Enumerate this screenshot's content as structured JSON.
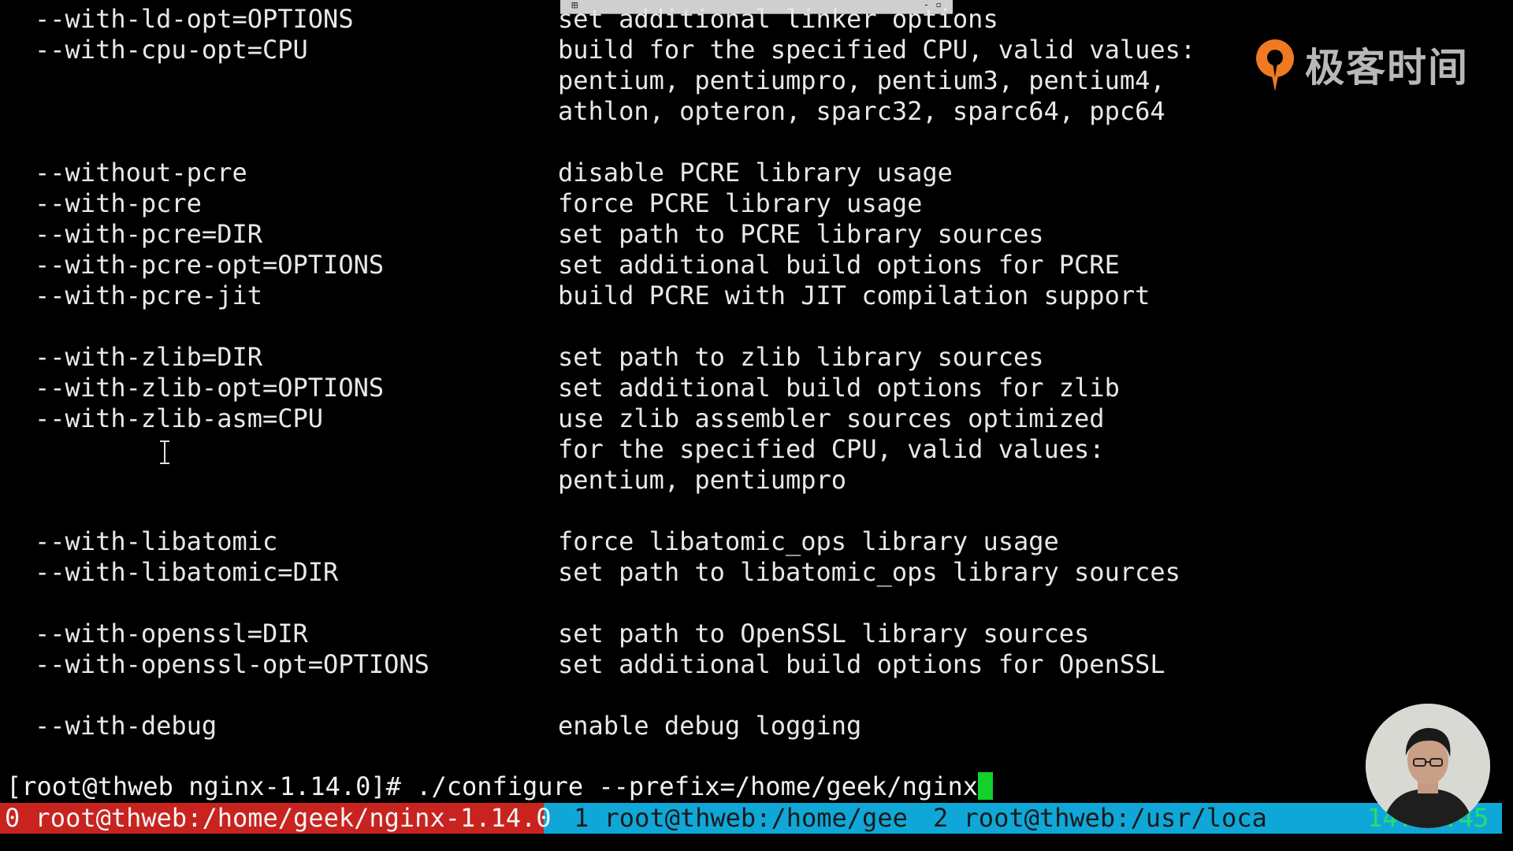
{
  "window": {
    "titlebar_left_symbol": "⊞",
    "titlebar_right_symbol": "- ▫"
  },
  "terminal": {
    "options": [
      {
        "option": "--with-ld-opt=OPTIONS",
        "desc": "set additional linker options"
      },
      {
        "option": "--with-cpu-opt=CPU",
        "desc": "build for the specified CPU, valid values:"
      },
      {
        "option": "",
        "desc": "pentium, pentiumpro, pentium3, pentium4,"
      },
      {
        "option": "",
        "desc": "athlon, opteron, sparc32, sparc64, ppc64"
      },
      {
        "option": "--without-pcre",
        "desc": "disable PCRE library usage"
      },
      {
        "option": "--with-pcre",
        "desc": "force PCRE library usage"
      },
      {
        "option": "--with-pcre=DIR",
        "desc": "set path to PCRE library sources"
      },
      {
        "option": "--with-pcre-opt=OPTIONS",
        "desc": "set additional build options for PCRE"
      },
      {
        "option": "--with-pcre-jit",
        "desc": "build PCRE with JIT compilation support"
      },
      {
        "option": "--with-zlib=DIR",
        "desc": "set path to zlib library sources"
      },
      {
        "option": "--with-zlib-opt=OPTIONS",
        "desc": "set additional build options for zlib"
      },
      {
        "option": "--with-zlib-asm=CPU",
        "desc": "use zlib assembler sources optimized"
      },
      {
        "option": "",
        "desc": "for the specified CPU, valid values:"
      },
      {
        "option": "",
        "desc": "pentium, pentiumpro"
      },
      {
        "option": "--with-libatomic",
        "desc": "force libatomic_ops library usage"
      },
      {
        "option": "--with-libatomic=DIR",
        "desc": "set path to libatomic_ops library sources"
      },
      {
        "option": "--with-openssl=DIR",
        "desc": "set path to OpenSSL library sources"
      },
      {
        "option": "--with-openssl-opt=OPTIONS",
        "desc": "set additional build options for OpenSSL"
      },
      {
        "option": "--with-debug",
        "desc": "enable debug logging"
      }
    ],
    "prompt": "[root@thweb nginx-1.14.0]# ",
    "command": "./configure --prefix=/home/geek/nginx"
  },
  "statusbar": {
    "windows": [
      {
        "label": "0 root@thweb:/home/geek/nginx-1.14.0",
        "active": true
      },
      {
        "label": "1 root@thweb:/home/gee",
        "active": false
      },
      {
        "label": "2 root@thweb:/usr/loca",
        "active": false
      }
    ],
    "clock": "14:55:45"
  },
  "logo": {
    "text": "极客时间"
  },
  "colors": {
    "background": "#000000",
    "foreground": "#e8e8e8",
    "cursor": "#11d12a",
    "statusbar": "#0fa7d8",
    "active_window": "#c8231f",
    "clock": "#25e066",
    "logo_orange": "#f07a22"
  }
}
